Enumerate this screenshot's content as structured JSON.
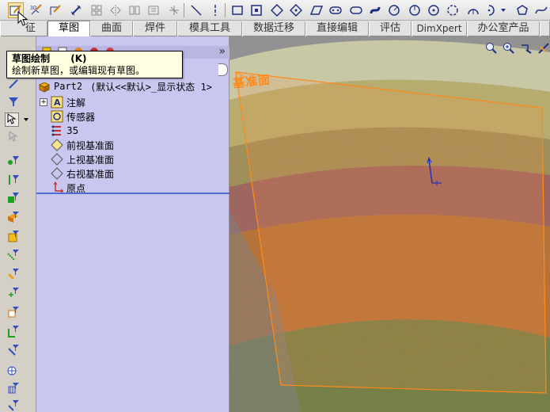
{
  "toolbar": {
    "tools": [
      {
        "name": "sketch-tool",
        "icon": "sketch-icon"
      },
      {
        "name": "3d-sketch-tool",
        "icon": "3d-sketch-icon"
      },
      {
        "name": "smart-dimension-tool",
        "icon": "smart-dimension-icon"
      },
      {
        "name": "linear-pattern-tool",
        "icon": "linear-pattern-icon"
      },
      {
        "name": "mirror-tool",
        "icon": "mirror-icon"
      },
      {
        "name": "trim-tool",
        "icon": "trim-icon"
      },
      {
        "name": "line-tool",
        "icon": "line-icon"
      },
      {
        "name": "centerline-tool",
        "icon": "centerline-icon"
      },
      {
        "name": "rectangle-tool",
        "icon": "rectangle-icon"
      },
      {
        "name": "square-tool",
        "icon": "square-icon"
      },
      {
        "name": "diamond-tool",
        "icon": "diamond-icon"
      },
      {
        "name": "parallelogram-tool",
        "icon": "parallelogram-icon"
      },
      {
        "name": "slot-tool",
        "icon": "slot-icon"
      },
      {
        "name": "circle-tool",
        "icon": "circle-icon"
      },
      {
        "name": "arc-tool",
        "icon": "arc-icon"
      },
      {
        "name": "ellipse-tool",
        "icon": "ellipse-icon"
      },
      {
        "name": "polygon-tool",
        "icon": "polygon-icon"
      },
      {
        "name": "spline-tool",
        "icon": "spline-icon"
      }
    ]
  },
  "tabs": {
    "items": [
      "征",
      "草图",
      "曲面",
      "焊件",
      "模具工具",
      "数据迁移",
      "直接编辑",
      "评估",
      "DimXpert",
      "办公室产品"
    ],
    "active": "草图"
  },
  "tooltip": {
    "title": "草图绘制",
    "shortcut": "(K)",
    "description": "绘制新草图，或编辑现有草图。"
  },
  "tree": {
    "root_part": "Part2",
    "root_config": "(默认<<默认>_显示状态 1>",
    "items": [
      {
        "label": "注解",
        "icon": "annotation-icon",
        "expandable": true
      },
      {
        "label": "传感器",
        "icon": "sensor-icon",
        "expandable": false
      },
      {
        "label": "35",
        "icon": "material-icon",
        "expandable": false
      },
      {
        "label": "前视基准面",
        "icon": "plane-icon",
        "expandable": false
      },
      {
        "label": "上视基准面",
        "icon": "plane-icon",
        "expandable": false
      },
      {
        "label": "右视基准面",
        "icon": "plane-icon",
        "expandable": false
      },
      {
        "label": "原点",
        "icon": "origin-icon",
        "expandable": false
      }
    ]
  },
  "viewport": {
    "plane_label": "基准面",
    "plane_color": "#ff8a1a"
  },
  "colors": {
    "panel_bg": "#c9c7f0",
    "tooltip_bg": "#ffffe1",
    "toolbar_icon": "#203080",
    "tree_separator": "#4a6fd0"
  }
}
